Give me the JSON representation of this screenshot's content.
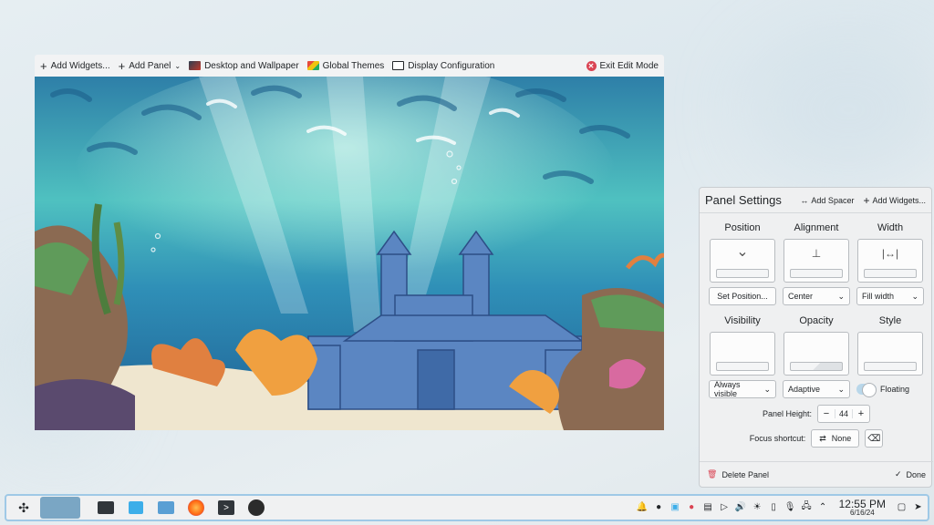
{
  "toolbar": {
    "add_widgets": "Add Widgets...",
    "add_panel": "Add Panel",
    "desktop_wallpaper": "Desktop and Wallpaper",
    "global_themes": "Global Themes",
    "display_config": "Display Configuration",
    "exit_edit": "Exit Edit Mode"
  },
  "panel_settings": {
    "title": "Panel Settings",
    "add_spacer": "Add Spacer",
    "add_widgets": "Add Widgets...",
    "position": {
      "label": "Position",
      "button": "Set Position..."
    },
    "alignment": {
      "label": "Alignment",
      "value": "Center"
    },
    "width": {
      "label": "Width",
      "value": "Fill width"
    },
    "visibility": {
      "label": "Visibility",
      "value": "Always visible"
    },
    "opacity": {
      "label": "Opacity",
      "value": "Adaptive"
    },
    "style": {
      "label": "Style",
      "toggle_label": "Floating",
      "floating": true
    },
    "height": {
      "label": "Panel Height:",
      "value": "44"
    },
    "shortcut": {
      "label": "Focus shortcut:",
      "value": "None"
    },
    "delete": "Delete Panel",
    "done": "Done"
  },
  "taskbar": {
    "clock_time": "12:55 PM",
    "clock_date": "6/16/24"
  },
  "colors": {
    "accent": "#3daee9",
    "danger": "#da4453",
    "panel_border": "#9fc9e6"
  },
  "icons": [
    "kickoff-icon",
    "pager-icon",
    "terminal-icon",
    "discover-icon",
    "dolphin-icon",
    "firefox-icon",
    "konsole-icon",
    "obs-icon"
  ]
}
